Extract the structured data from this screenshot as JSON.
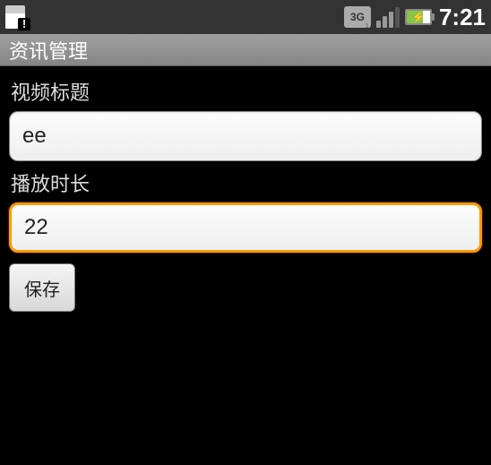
{
  "status_bar": {
    "threeg_label": "3G",
    "clock": "7:21"
  },
  "title_bar": {
    "title": "资讯管理"
  },
  "form": {
    "video_title": {
      "label": "视频标题",
      "value": "ee"
    },
    "duration": {
      "label": "播放时长",
      "value": "22"
    },
    "save_button_label": "保存"
  }
}
